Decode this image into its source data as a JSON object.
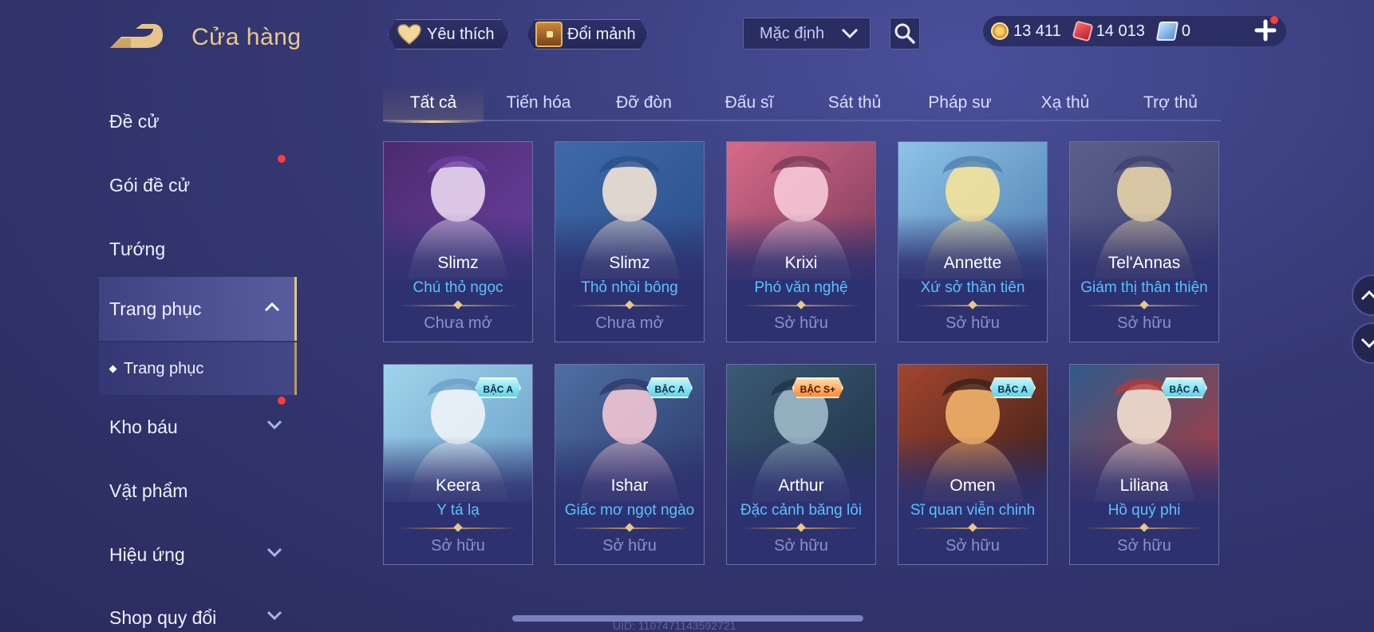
{
  "header": {
    "title": "Cửa hàng",
    "favorite_label": "Yêu thích",
    "shards_label": "Đổi mảnh",
    "sort_value": "Mặc định",
    "currencies": [
      {
        "icon": "gold-coin-icon",
        "value": "13 411"
      },
      {
        "icon": "red-gem-icon",
        "value": "14 013"
      },
      {
        "icon": "voucher-icon",
        "value": "0"
      }
    ]
  },
  "sidebar": {
    "items": [
      {
        "label": "Đề cử"
      },
      {
        "label": "Gói đề cử"
      },
      {
        "label": "Tướng"
      },
      {
        "label": "Trang phục"
      },
      {
        "label": "Kho báu"
      },
      {
        "label": "Vật phẩm"
      },
      {
        "label": "Hiệu ứng"
      },
      {
        "label": "Shop quy đổi"
      }
    ],
    "sub_item": "Trang phục"
  },
  "tabs": [
    "Tất cả",
    "Tiến hóa",
    "Đỡ đòn",
    "Đấu sĩ",
    "Sát thủ",
    "Pháp sư",
    "Xạ thủ",
    "Trợ thủ"
  ],
  "cards": [
    {
      "hero": "Slimz",
      "skin": "Chú thỏ ngọc",
      "status": "Chưa mở",
      "badge": "",
      "colors": [
        "#4c2b6e",
        "#e9d7ef",
        "#6b3fa0"
      ]
    },
    {
      "hero": "Slimz",
      "skin": "Thỏ nhồi bông",
      "status": "Chưa mở",
      "badge": "",
      "colors": [
        "#3e6aa8",
        "#f2e3d6",
        "#2b4f8a"
      ]
    },
    {
      "hero": "Krixi",
      "skin": "Phó văn nghệ",
      "status": "Sở hữu",
      "badge": "",
      "colors": [
        "#d86a8a",
        "#f7c9d8",
        "#7a3a5a"
      ]
    },
    {
      "hero": "Annette",
      "skin": "Xứ sở thần tiên",
      "status": "Sở hữu",
      "badge": "",
      "colors": [
        "#8fc3e8",
        "#f7e39b",
        "#4f7fb0"
      ]
    },
    {
      "hero": "Tel'Annas",
      "skin": "Giám thị thân thiện",
      "status": "Sở hữu",
      "badge": "",
      "colors": [
        "#5a5f8a",
        "#e7d3a8",
        "#3d4170"
      ]
    },
    {
      "hero": "Keera",
      "skin": "Y tá lạ",
      "status": "Sở hữu",
      "badge": "BẬC A",
      "colors": [
        "#9fd4ea",
        "#f0f4fa",
        "#6a9ec8"
      ]
    },
    {
      "hero": "Ishar",
      "skin": "Giấc mơ ngọt ngào",
      "status": "Sở hữu",
      "badge": "BẬC A",
      "colors": [
        "#4e6fa3",
        "#f2c6d4",
        "#2c3a6a"
      ]
    },
    {
      "hero": "Arthur",
      "skin": "Đặc cảnh băng lôi",
      "status": "Sở hữu",
      "badge": "BẬC S+",
      "colors": [
        "#3b5a73",
        "#9fb9c9",
        "#1f3347"
      ]
    },
    {
      "hero": "Omen",
      "skin": "Sĩ quan viễn chinh",
      "status": "Sở hữu",
      "badge": "BẬC A",
      "colors": [
        "#a3452e",
        "#f2b26a",
        "#3a1f1a"
      ]
    },
    {
      "hero": "Liliana",
      "skin": "Hồ quý phi",
      "status": "Sở hữu",
      "badge": "BẬC A",
      "colors": [
        "#2f5a8a",
        "#f4e0d0",
        "#b23a3a"
      ]
    }
  ],
  "footer": {
    "uid": "UID: 1107471143592721"
  },
  "colors": {
    "accent_gold": "#e8c98a",
    "skin_blue": "#59c2ff",
    "notification_red": "#ff3b3b"
  }
}
